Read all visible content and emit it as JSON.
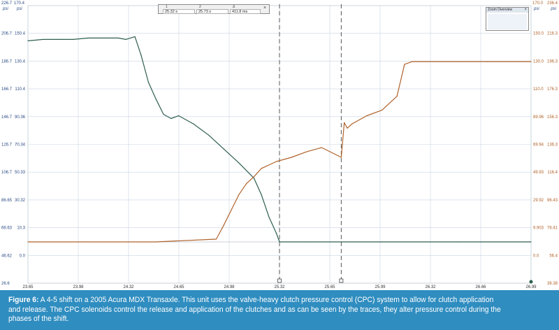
{
  "axes": {
    "left_outer": {
      "unit": "psi",
      "color": "#2a4b86",
      "top_label": "226.7",
      "ticks": [
        "206.7",
        "186.7",
        "166.7",
        "146.7",
        "126.7",
        "106.7",
        "86.65",
        "66.63",
        "46.62",
        "26.6"
      ]
    },
    "left_inner": {
      "unit": "psi",
      "color": "#2a4b86",
      "top_label": "170.4",
      "ticks": [
        "150.4",
        "130.4",
        "110.4",
        "90.36",
        "70.34",
        "50.33",
        "30.32",
        "10.3",
        "0.0"
      ]
    },
    "right_inner": {
      "unit": "psi",
      "color": "#b0622a",
      "top_label": "170.0",
      "ticks": [
        "150.0",
        "130.0",
        "110.0",
        "89.96",
        "69.94",
        "49.93",
        "29.92",
        "9.903",
        "0.0"
      ]
    },
    "right_outer": {
      "unit": "psi",
      "color": "#b0622a",
      "top_label": "236.4",
      "ticks": [
        "216.3",
        "196.3",
        "176.3",
        "156.3",
        "136.3",
        "116.4",
        "96.43",
        "76.41",
        "56.4",
        "36.38"
      ]
    },
    "x_ticks": [
      "23.65",
      "23.98",
      "24.32",
      "24.65",
      "24.98",
      "25.32",
      "25.65",
      "25.99",
      "26.32",
      "26.66",
      "26.99"
    ]
  },
  "ruler": {
    "col1_label": "1",
    "col2_label": "2",
    "col3_label": "Δ",
    "cursor1": "25.32 s",
    "cursor2": "25.73 s",
    "delta": "411.8 ms",
    "close_symbol": "×"
  },
  "zoom_overview": {
    "title": "Zoom Overview",
    "close_symbol": "×"
  },
  "caption": {
    "lead": "Figure 6:",
    "text": " A 4-5 shift on a 2005 Acura MDX Transaxle. This unit uses the valve-heavy clutch pressure control (CPC) system to allow for clutch application and release. The CPC solenoids control the release and application of the clutches and as can be seen by the traces, they alter pressure control during the phases of the shift."
  },
  "chart_data": {
    "type": "line",
    "x_unit": "s",
    "xlim": [
      23.65,
      26.99
    ],
    "ylim": [
      0.0,
      170.4
    ],
    "cursors": [
      25.32,
      25.73
    ],
    "series": [
      {
        "color": "#2e5e4e",
        "x": [
          23.65,
          23.75,
          23.85,
          23.95,
          24.05,
          24.15,
          24.25,
          24.3,
          24.36,
          24.4,
          24.45,
          24.5,
          24.55,
          24.6,
          24.65,
          24.75,
          24.85,
          24.95,
          25.05,
          25.15,
          25.2,
          25.25,
          25.3,
          25.32,
          25.5,
          25.73,
          26.0,
          26.5,
          26.99
        ],
        "y": [
          145,
          146,
          146,
          146,
          147,
          147,
          147,
          146,
          148,
          135,
          115,
          103,
          92,
          89,
          91,
          85,
          77,
          67,
          57,
          46,
          34,
          18,
          6,
          0.0,
          0.0,
          0.0,
          0.0,
          0.0,
          0.0
        ]
      },
      {
        "color": "#b0622a",
        "x": [
          23.65,
          24.0,
          24.5,
          24.9,
          24.95,
          25.0,
          25.05,
          25.1,
          25.15,
          25.2,
          25.3,
          25.4,
          25.5,
          25.6,
          25.73,
          25.75,
          25.77,
          25.8,
          25.85,
          25.9,
          26.0,
          26.1,
          26.15,
          26.2,
          26.3,
          26.5,
          26.7,
          26.99
        ],
        "y": [
          0.0,
          0.0,
          0.0,
          2,
          12,
          23,
          34,
          42,
          47,
          53,
          58,
          61,
          65,
          68,
          61,
          86,
          82,
          85,
          88,
          91,
          95,
          105,
          128,
          130,
          130,
          130,
          130,
          130
        ]
      }
    ]
  }
}
